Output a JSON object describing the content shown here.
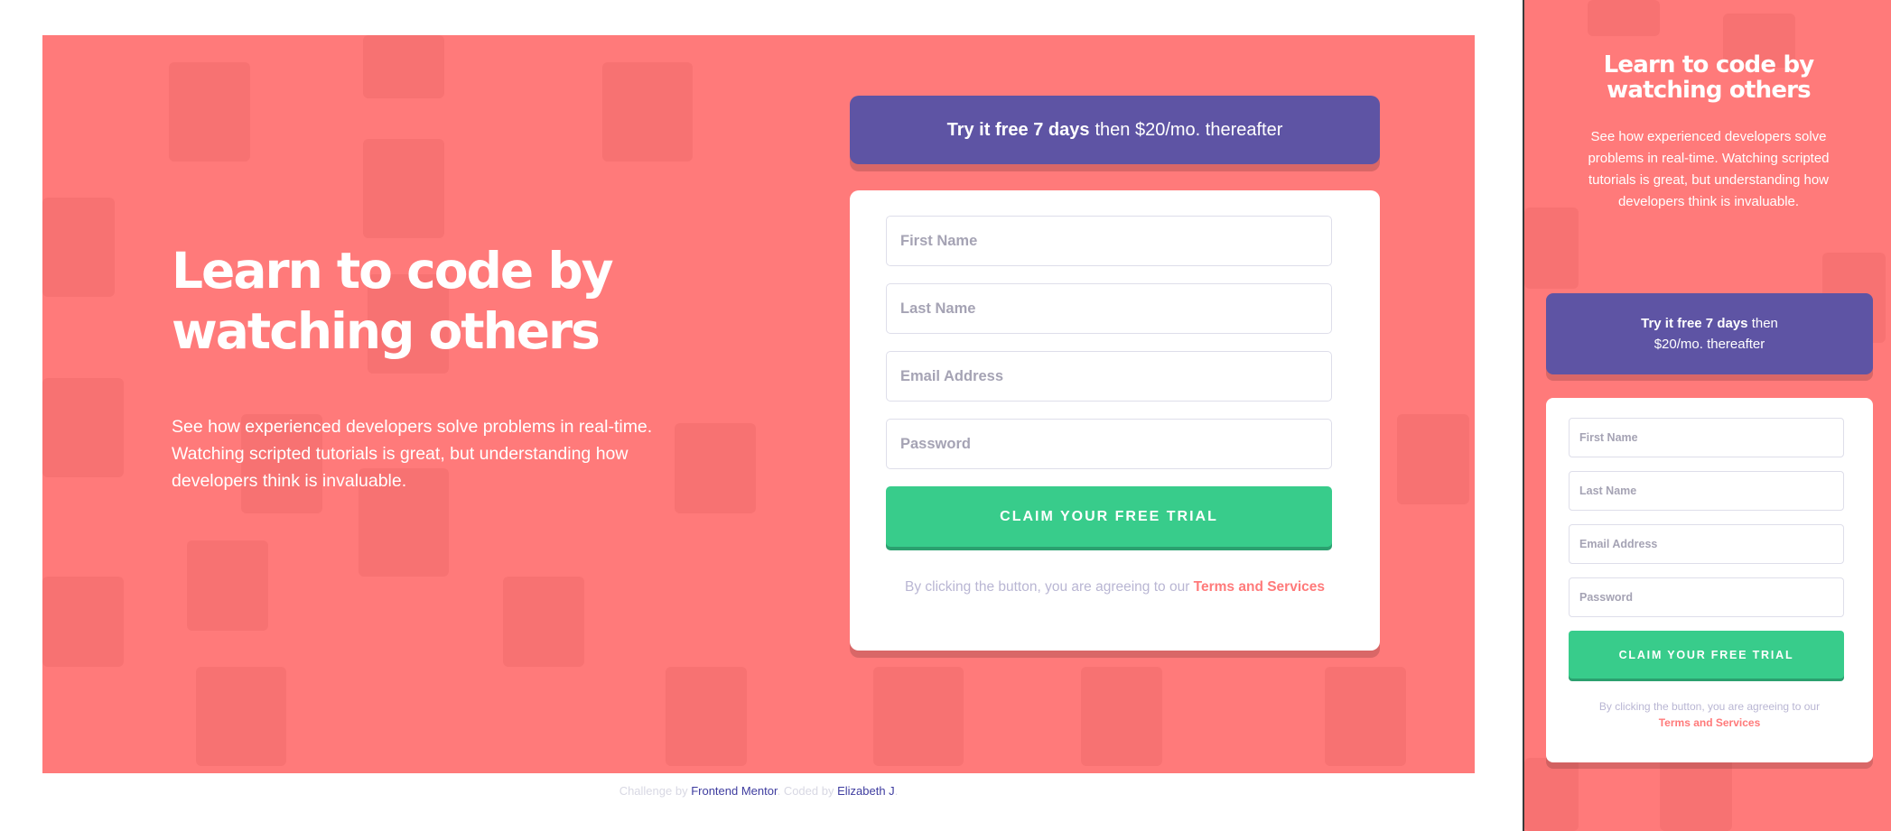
{
  "desktop": {
    "title_line1": "Learn to code by",
    "title_line2": "watching others",
    "description_line1": "See how experienced developers solve problems in real-time.",
    "description_line2": "Watching scripted tutorials is great, but understanding how",
    "description_line3": "developers think is invaluable.",
    "banner_bold": "Try it free 7 days",
    "banner_rest": "then $20/mo. thereafter",
    "form": {
      "first_name": "First Name",
      "last_name": "Last Name",
      "email": "Email Address",
      "password": "Password",
      "submit": "CLAIM YOUR FREE TRIAL",
      "terms_prefix": "By clicking the button, you are agreeing to our",
      "terms_link": "Terms and Services"
    }
  },
  "footer": {
    "challenge_by": "Challenge by",
    "frontend_mentor": "Frontend Mentor",
    "coded_by": ". Coded by",
    "author": "Elizabeth J",
    "end": "."
  },
  "mobile": {
    "title_line1": "Learn to code by",
    "title_line2": "watching others",
    "description": "See how experienced developers solve problems in real-time. Watching scripted tutorials is great, but understanding how developers think is invaluable.",
    "banner_bold": "Try it free 7 days",
    "banner_rest": "then $20/mo. thereafter",
    "form": {
      "first_name": "First Name",
      "last_name": "Last Name",
      "email": "Email Address",
      "password": "Password",
      "submit": "CLAIM YOUR FREE TRIAL",
      "terms_prefix": "By clicking the button, you are agreeing to our",
      "terms_link": "Terms and Services"
    }
  },
  "colors": {
    "background": "#ff7a7a",
    "banner": "#5e54a4",
    "button": "#38cc8b",
    "placeholder": "#a5a3b4",
    "terms_text": "#b9b6d3"
  }
}
